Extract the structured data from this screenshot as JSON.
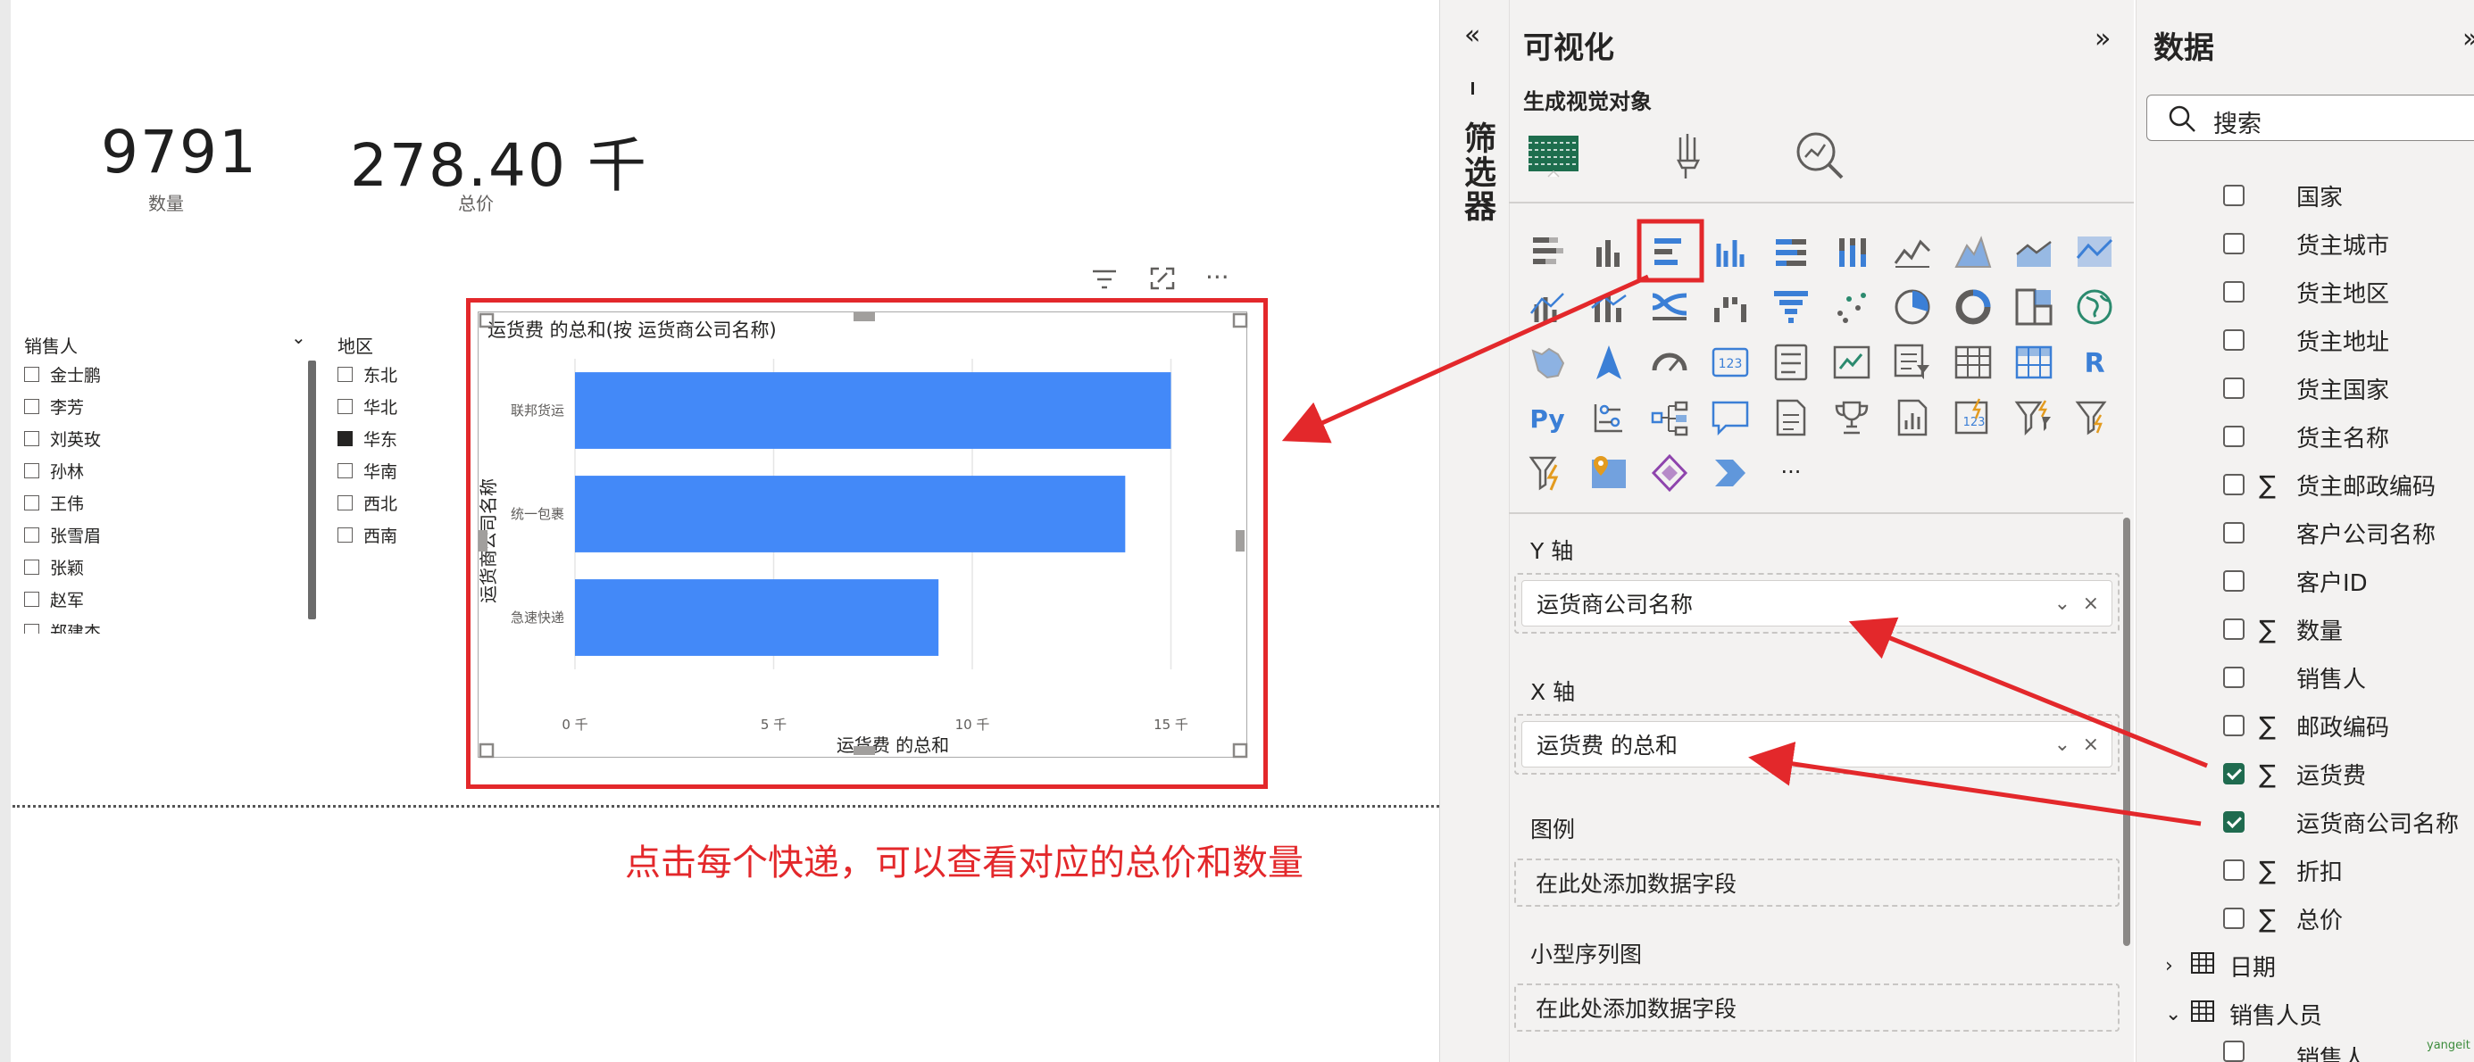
{
  "cards": [
    {
      "value": "9791",
      "label": "数量"
    },
    {
      "value": "278.40 千",
      "label": "总价"
    }
  ],
  "slicers": {
    "salesperson": {
      "title": "销售人",
      "items": [
        "金士鹏",
        "李芳",
        "刘英玫",
        "孙林",
        "王伟",
        "张雪眉",
        "张颖",
        "赵军",
        "郑建杰"
      ]
    },
    "region": {
      "title": "地区",
      "items": [
        {
          "label": "东北",
          "checked": false
        },
        {
          "label": "华北",
          "checked": false
        },
        {
          "label": "华东",
          "checked": true
        },
        {
          "label": "华南",
          "checked": false
        },
        {
          "label": "西北",
          "checked": false
        },
        {
          "label": "西南",
          "checked": false
        }
      ]
    }
  },
  "visual_toolbar": {
    "filter_icon": "filter-lines-icon",
    "focus_icon": "focus-mode-icon",
    "more_icon": "more-options-icon",
    "more_label": "···"
  },
  "chart_data": {
    "type": "bar",
    "orientation": "horizontal",
    "title": "运货费 的总和(按 运货商公司名称)",
    "xlabel": "运货费 的总和",
    "ylabel": "运货商公司名称",
    "categories": [
      "联邦货运",
      "统一包裹",
      "急速快递"
    ],
    "values": [
      15000,
      13850,
      9150
    ],
    "xlim": [
      0,
      16000
    ],
    "xticks": [
      0,
      5000,
      10000,
      15000
    ],
    "xtick_labels": [
      "0 千",
      "5 千",
      "10 千",
      "15 千"
    ],
    "bar_color": "#4389f8",
    "grid": true
  },
  "annotation": {
    "text": "点击每个快递，可以查看对应的总价和数量",
    "color": "#e3282b"
  },
  "filters_pane": {
    "label": "筛选器",
    "collapse_icon": "double-chevron-left-icon"
  },
  "viz_pane": {
    "title": "可视化",
    "expand_icon": "double-chevron-right-icon",
    "subtitle": "生成视觉对象",
    "mode_icons": [
      "build-visual-icon",
      "format-brush-icon",
      "analytics-magnifier-icon"
    ],
    "r_label": "R",
    "py_label": "Py",
    "more_label": "···",
    "wells": [
      {
        "label": "Y 轴",
        "field": "运货商公司名称"
      },
      {
        "label": "X 轴",
        "field": "运货费 的总和"
      }
    ],
    "empty_wells": [
      {
        "label": "图例",
        "placeholder": "在此处添加数据字段"
      },
      {
        "label": "小型序列图",
        "placeholder": "在此处添加数据字段"
      }
    ]
  },
  "data_pane": {
    "title": "数据",
    "search_placeholder": "搜索",
    "fields": [
      {
        "name": "国家",
        "sigma": false,
        "checked": false
      },
      {
        "name": "货主城市",
        "sigma": false,
        "checked": false
      },
      {
        "name": "货主地区",
        "sigma": false,
        "checked": false
      },
      {
        "name": "货主地址",
        "sigma": false,
        "checked": false
      },
      {
        "name": "货主国家",
        "sigma": false,
        "checked": false
      },
      {
        "name": "货主名称",
        "sigma": false,
        "checked": false
      },
      {
        "name": "货主邮政编码",
        "sigma": true,
        "checked": false
      },
      {
        "name": "客户公司名称",
        "sigma": false,
        "checked": false
      },
      {
        "name": "客户ID",
        "sigma": false,
        "checked": false
      },
      {
        "name": "数量",
        "sigma": true,
        "checked": false
      },
      {
        "name": "销售人",
        "sigma": false,
        "checked": false
      },
      {
        "name": "邮政编码",
        "sigma": true,
        "checked": false
      },
      {
        "name": "运货费",
        "sigma": true,
        "checked": true
      },
      {
        "name": "运货商公司名称",
        "sigma": false,
        "checked": true
      },
      {
        "name": "折扣",
        "sigma": true,
        "checked": false
      },
      {
        "name": "总价",
        "sigma": true,
        "checked": false
      }
    ],
    "tables": [
      {
        "name": "日期",
        "expanded": false
      },
      {
        "name": "销售人员",
        "expanded": true
      }
    ],
    "partial_field": "销售人",
    "sigma_label": "∑",
    "watermark": "yangeit"
  }
}
